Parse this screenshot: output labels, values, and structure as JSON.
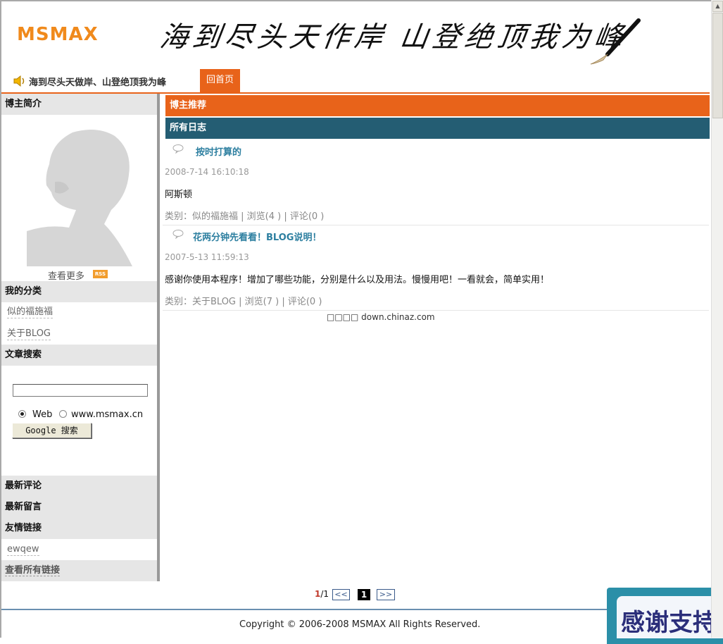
{
  "header": {
    "logo": "MSMAX",
    "banner_text": "海到尽头天作岸 山登绝顶我为峰",
    "motto": "海到尽头天做岸、山登绝顶我为峰",
    "home_tab": "回首页"
  },
  "sidebar": {
    "about_title": "博主简介",
    "view_more": "查看更多",
    "rss_badge": "RSS",
    "categories_title": "我的分类",
    "categories": [
      "似的福施福",
      "关于BLOG"
    ],
    "search_title": "文章搜索",
    "search": {
      "value": "",
      "radio_web": "Web",
      "radio_site": "www.msmax.cn",
      "button": "Google 搜索"
    },
    "latest_comments_title": "最新评论",
    "latest_messages_title": "最新留言",
    "links_title": "友情链接",
    "links": [
      "ewqew"
    ],
    "all_links": "查看所有链接"
  },
  "main": {
    "recommend_title": "博主推荐",
    "all_posts_title": "所有日志",
    "posts": [
      {
        "title": "按时打算的",
        "date": "2008-7-14 16:10:18",
        "body": "阿斯顿",
        "meta": "类别：似的福施福 | 浏览(4 ) | 评论(0 )"
      },
      {
        "title": "花两分钟先看看！BLOG说明！",
        "date": "2007-5-13 11:59:13",
        "body": "感谢你使用本程序！增加了哪些功能，分别是什么以及用法。慢慢用吧！一看就会，简单实用！",
        "meta": "类别：关于BLOG | 浏览(7 ) | 评论(0 )"
      }
    ],
    "source_note": "□□□□ down.chinaz.com"
  },
  "pager": {
    "current": "1",
    "total": "/1",
    "prev": "<<",
    "active_page": "1",
    "next": ">>"
  },
  "footer": {
    "copyright": "Copyright © 2006-2008 MSMAX All Rights Reserved."
  },
  "floating_badge": {
    "text": "感谢支持"
  },
  "colors": {
    "accent_orange": "#e8631a",
    "bar_teal": "#245d73",
    "link_blue": "#2d7fa0",
    "logo_orange": "#f08a1c"
  }
}
